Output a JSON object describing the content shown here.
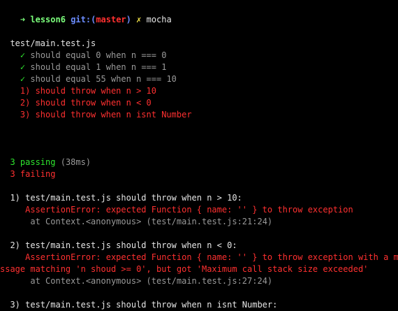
{
  "colors": {
    "background": "#000000",
    "pass": "#2ee62e",
    "fail": "#ff3030",
    "branch": "#ff3030",
    "prompt_dir": "#7cff7c",
    "git": "#6b8cff",
    "text": "#e6e6e6",
    "muted": "#9a9a9a"
  },
  "prompt": {
    "arrow": "➜",
    "dir": "lesson6",
    "git_label": "git:(",
    "branch": "master",
    "git_close": ")",
    "dirty_mark": "✗",
    "command": "mocha"
  },
  "suite": {
    "file": "test/main.test.js",
    "passed": [
      {
        "check": "✓",
        "title": "should equal 0 when n === 0"
      },
      {
        "check": "✓",
        "title": "should equal 1 when n === 1"
      },
      {
        "check": "✓",
        "title": "should equal 55 when n === 10"
      }
    ],
    "failed": [
      {
        "label": "1) should throw when n > 10"
      },
      {
        "label": "2) should throw when n < 0"
      },
      {
        "label": "3) should throw when n isnt Number"
      }
    ]
  },
  "summary": {
    "passing_count": "3 passing",
    "passing_time": "(38ms)",
    "failing_count": "3 failing"
  },
  "failures": [
    {
      "header": "1) test/main.test.js should throw when n > 10:",
      "error_lines": [
        "AssertionError: expected Function { name: '' } to throw exception"
      ],
      "stack": "at Context.<anonymous> (test/main.test.js:21:24)"
    },
    {
      "header": "2) test/main.test.js should throw when n < 0:",
      "error_lines": [
        "AssertionError: expected Function { name: '' } to throw exception with a me",
        "ssage matching 'n shoud >= 0', but got 'Maximum call stack size exceeded'"
      ],
      "stack": "at Context.<anonymous> (test/main.test.js:27:24)"
    },
    {
      "header": "3) test/main.test.js should throw when n isnt Number:"
    }
  ]
}
